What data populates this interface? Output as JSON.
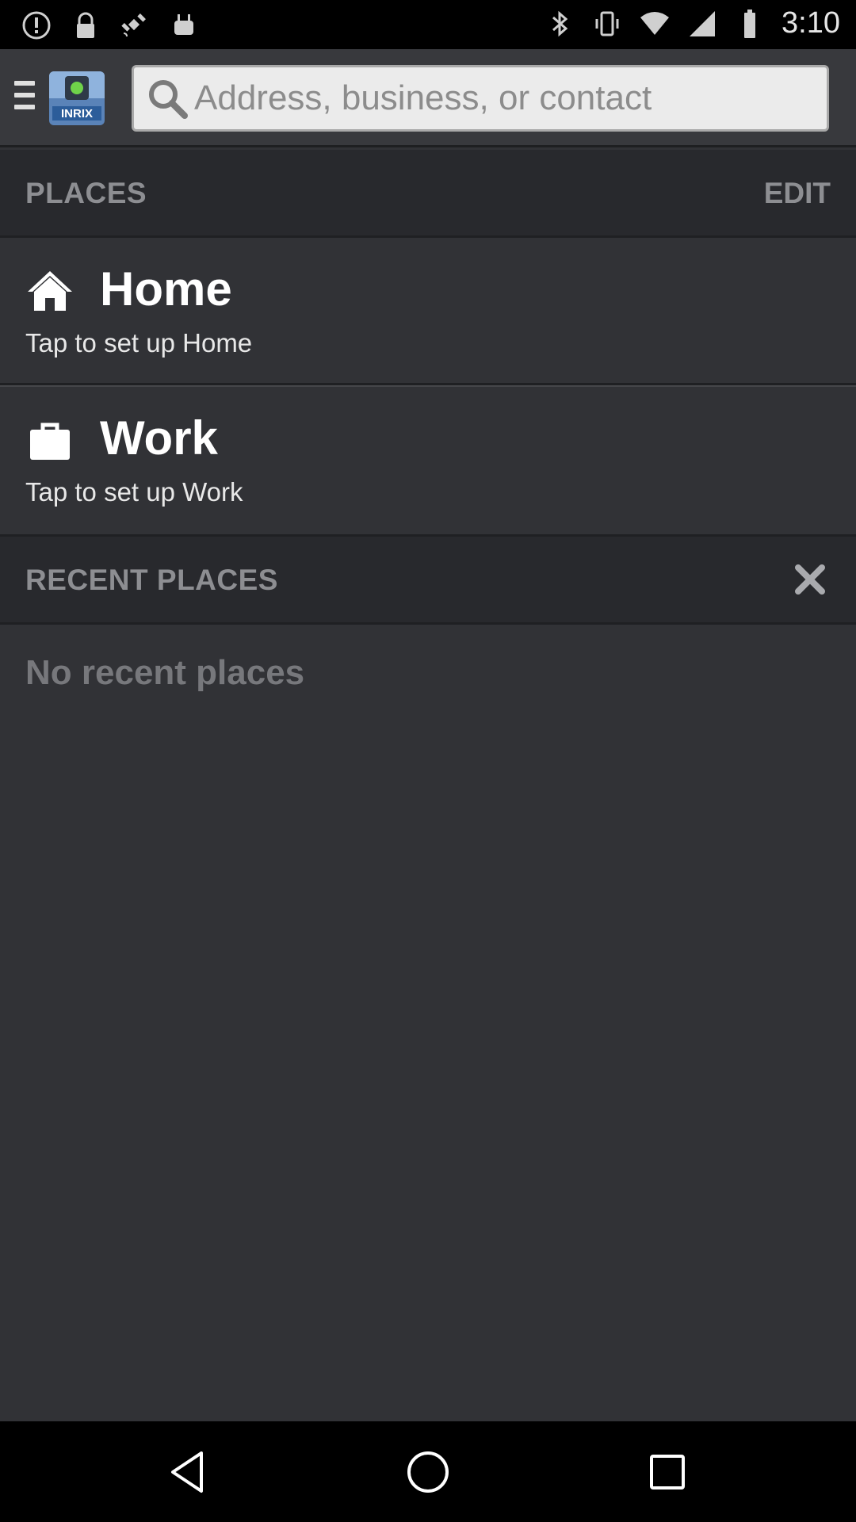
{
  "status_bar": {
    "time": "3:10",
    "left_icons": [
      "alert-icon",
      "lock-icon",
      "satellite-icon",
      "android-icon"
    ],
    "right_icons": [
      "bluetooth-icon",
      "vibrate-icon",
      "wifi-icon",
      "signal-icon",
      "battery-icon"
    ]
  },
  "app_bar": {
    "logo_text": "INRIX",
    "search_placeholder": "Address, business, or contact"
  },
  "places": {
    "header": "PLACES",
    "edit_label": "EDIT",
    "items": [
      {
        "icon": "home-icon",
        "title": "Home",
        "subtitle": "Tap to set up Home"
      },
      {
        "icon": "briefcase-icon",
        "title": "Work",
        "subtitle": "Tap to set up Work"
      }
    ]
  },
  "recent_places": {
    "header": "RECENT PLACES",
    "empty_message": "No recent places"
  },
  "nav_bar": {
    "buttons": [
      "back-icon",
      "home-icon",
      "recents-icon"
    ]
  },
  "colors": {
    "background": "#313236",
    "header_bg": "#28292d",
    "header_text": "#8d8e92",
    "title_text": "#ffffff"
  }
}
